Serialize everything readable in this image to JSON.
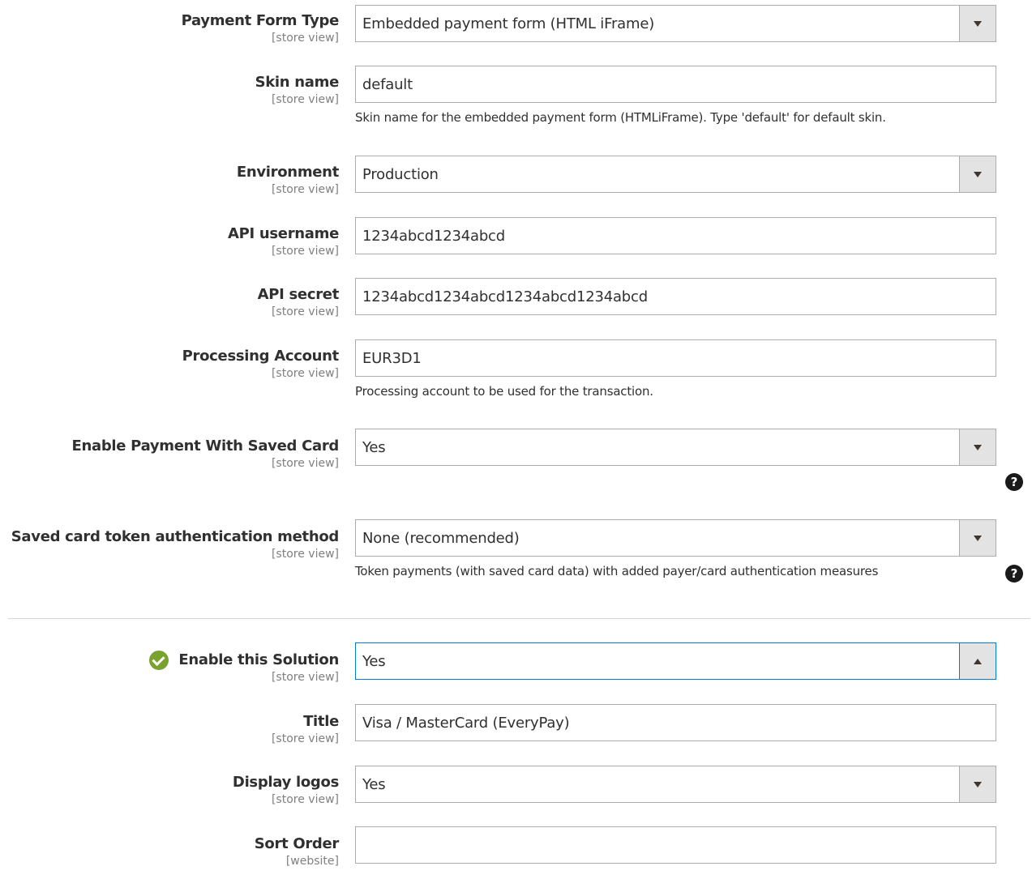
{
  "fields": {
    "payment_form_type": {
      "label": "Payment Form Type",
      "scope": "[store view]",
      "value": "Embedded payment form (HTML iFrame)"
    },
    "skin_name": {
      "label": "Skin name",
      "scope": "[store view]",
      "value": "default",
      "note": "Skin name for the embedded payment form (HTMLiFrame). Type 'default' for default skin."
    },
    "environment": {
      "label": "Environment",
      "scope": "[store view]",
      "value": "Production"
    },
    "api_username": {
      "label": "API username",
      "scope": "[store view]",
      "value": "1234abcd1234abcd"
    },
    "api_secret": {
      "label": "API secret",
      "scope": "[store view]",
      "value": "1234abcd1234abcd1234abcd1234abcd"
    },
    "processing_account": {
      "label": "Processing Account",
      "scope": "[store view]",
      "value": "EUR3D1",
      "note": "Processing account to be used for the transaction."
    },
    "enable_saved_card": {
      "label": "Enable Payment With Saved Card",
      "scope": "[store view]",
      "value": "Yes"
    },
    "token_auth_method": {
      "label": "Saved card token authentication method",
      "scope": "[store view]",
      "value": "None (recommended)",
      "note": "Token payments (with saved card data) with added payer/card authentication measures"
    },
    "enable_solution": {
      "label": "Enable this Solution",
      "scope": "[store view]",
      "value": "Yes"
    },
    "title": {
      "label": "Title",
      "scope": "[store view]",
      "value": "Visa / MasterCard (EveryPay)"
    },
    "display_logos": {
      "label": "Display logos",
      "scope": "[store view]",
      "value": "Yes"
    },
    "sort_order": {
      "label": "Sort Order",
      "scope": "[website]",
      "value": ""
    }
  },
  "icons": {
    "help": "?",
    "status_check": "check-circle-icon"
  },
  "colors": {
    "focus_border": "#007bdb",
    "check_green": "#79a22e",
    "arrow_bg": "#e3e3e3"
  }
}
